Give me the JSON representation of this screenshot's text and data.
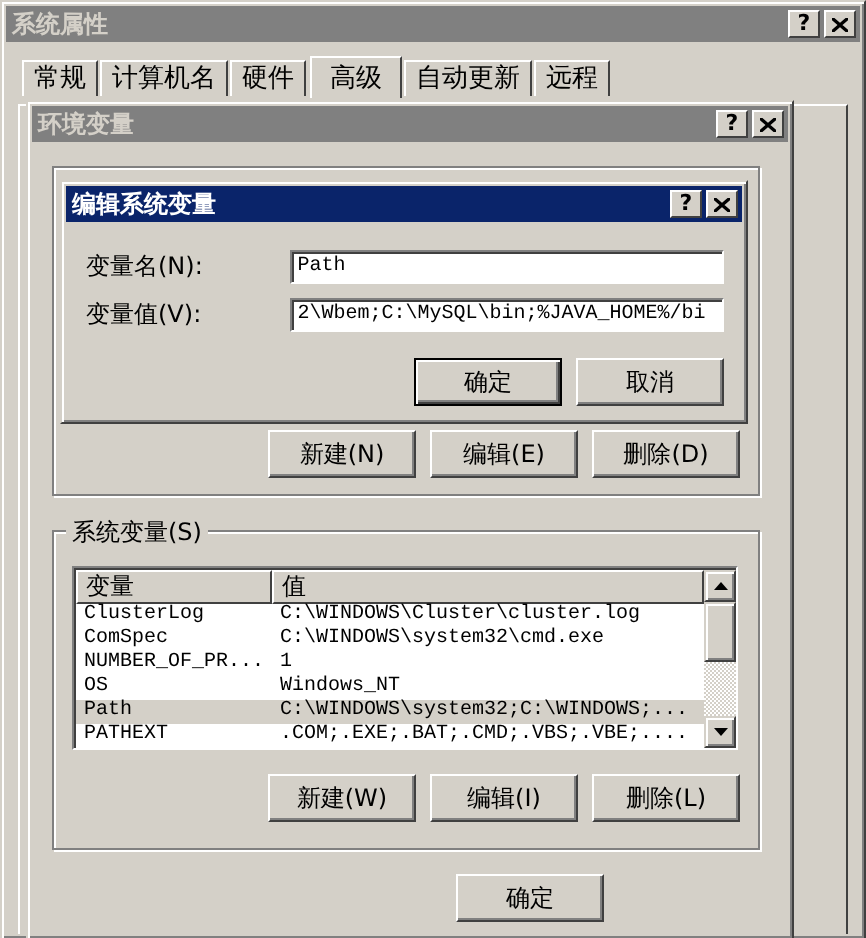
{
  "system_properties": {
    "title": "系统属性",
    "active": false,
    "help": "?",
    "tabs": [
      {
        "label": "常规",
        "selected": false
      },
      {
        "label": "计算机名",
        "selected": false
      },
      {
        "label": "硬件",
        "selected": false
      },
      {
        "label": "高级",
        "selected": true
      },
      {
        "label": "自动更新",
        "selected": false
      },
      {
        "label": "远程",
        "selected": false
      }
    ]
  },
  "environment_variables": {
    "title": "环境变量",
    "active": false,
    "help": "?",
    "user_variable_buttons": [
      "新建(N)",
      "编辑(E)",
      "删除(D)"
    ],
    "system_variables": {
      "label": "系统变量(S)",
      "columns": [
        "变量",
        "值"
      ],
      "rows": [
        {
          "name": "ClusterLog",
          "value": "C:\\WINDOWS\\Cluster\\cluster.log",
          "selected": false
        },
        {
          "name": "ComSpec",
          "value": "C:\\WINDOWS\\system32\\cmd.exe",
          "selected": false
        },
        {
          "name": "NUMBER_OF_PR...",
          "value": "1",
          "selected": false
        },
        {
          "name": "OS",
          "value": "Windows_NT",
          "selected": false
        },
        {
          "name": "Path",
          "value": "C:\\WINDOWS\\system32;C:\\WINDOWS;...",
          "selected": true
        },
        {
          "name": "PATHEXT",
          "value": ".COM;.EXE;.BAT;.CMD;.VBS;.VBE;....",
          "selected": false
        }
      ]
    },
    "system_variable_buttons": [
      "新建(W)",
      "编辑(I)",
      "删除(L)"
    ],
    "buttons": [
      "确定"
    ]
  },
  "edit_dialog": {
    "title": "编辑系统变量",
    "active": true,
    "help": "?",
    "fields": [
      {
        "label": "变量名(N):",
        "value": "Path"
      },
      {
        "label": "变量值(V):",
        "value": "2\\Wbem;C:\\MySQL\\bin;%JAVA_HOME%/bi"
      }
    ],
    "buttons": [
      {
        "label": "确定",
        "default": true
      },
      {
        "label": "取消",
        "default": false
      }
    ]
  }
}
